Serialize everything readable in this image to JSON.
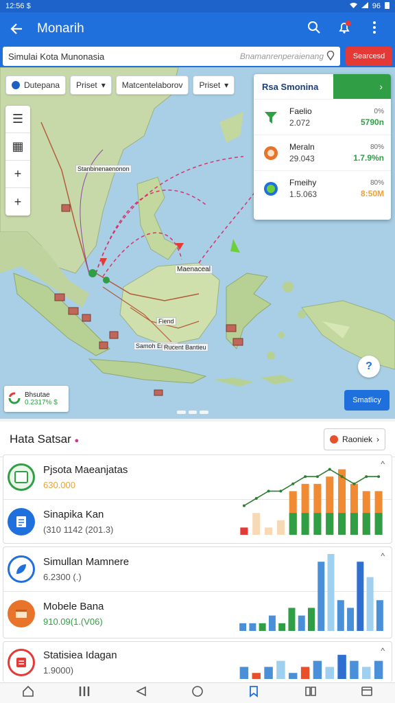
{
  "status_bar": {
    "time": "12:56 $",
    "battery": "96"
  },
  "app_bar": {
    "title": "Monarih"
  },
  "search": {
    "value": "Simulai Kota Munonasia",
    "hint": "Bnamanrenperaienang",
    "button": "Searcesd"
  },
  "filters": [
    "Dutepana",
    "Priset",
    "Matcentelaborov",
    "Priset"
  ],
  "map_labels": {
    "top": "Stanbinenaenonon",
    "center": "Maenaceal",
    "small1": "Samoh Enitoin",
    "small2": "Fiend",
    "small3": "Rucent Bantieu"
  },
  "legend": {
    "title": "Rsa Smonina",
    "rows": [
      {
        "name": "Faelio",
        "value": "2.072",
        "pct": "0%",
        "amount": "5790n",
        "amount_color": "#2f9e44"
      },
      {
        "name": "Meraln",
        "value": "29.043",
        "pct": "80%",
        "amount": "1.7.9%n",
        "amount_color": "#2f9e44"
      },
      {
        "name": "Fmeihy",
        "value": "1.5.063",
        "pct": "80%",
        "amount": "8:50M",
        "amount_color": "#e8a33b"
      }
    ]
  },
  "mini_card": {
    "label": "Bhsutae",
    "value": "0.2317% $"
  },
  "map_action": "Smatlicy",
  "data_section": {
    "title": "Hata Satsar",
    "report_button": "Raoniek",
    "rows": [
      {
        "title": "Pjsota Maeanjatas",
        "sub": "630.000",
        "sub_color": "#e8a33b"
      },
      {
        "title": "Sinapika Kan",
        "sub": "(310 1142 (201.3)",
        "sub_color": "#555"
      },
      {
        "title": "Simullan Mamnere",
        "sub": "6.2300 (.)",
        "sub_color": "#555"
      },
      {
        "title": "Mobele Bana",
        "sub": "910.09(1.(V06)",
        "sub_color": "#2f9e44"
      },
      {
        "title": "Statisiea Idagan",
        "sub": "1.9000)",
        "sub_color": "#555"
      }
    ]
  },
  "chart_data": [
    {
      "type": "bar",
      "series": [
        {
          "values": [
            1,
            3,
            1,
            2,
            6,
            7,
            7,
            8,
            9,
            7,
            6,
            6
          ],
          "color": "#f08a33"
        },
        {
          "values": [
            0,
            0,
            0,
            0,
            3,
            3,
            3,
            3,
            3,
            3,
            3,
            3
          ],
          "color": "#2f9e44"
        }
      ],
      "line": [
        4,
        5,
        6,
        6,
        7,
        8,
        8,
        9,
        8,
        7,
        8,
        8
      ],
      "ylim": [
        0,
        10
      ]
    },
    {
      "type": "bar",
      "values": [
        1,
        1,
        1,
        2,
        1,
        3,
        2,
        3,
        9,
        10,
        4,
        3,
        9,
        7,
        4
      ],
      "colors": [
        "#4a90d9",
        "#4a90d9",
        "#2f9e44",
        "#4a90d9",
        "#2f9e44",
        "#2f9e44",
        "#4a90d9",
        "#2f9e44",
        "#4a90d9",
        "#9fd0f0",
        "#4a90d9",
        "#4a90d9",
        "#2f6fd0",
        "#9fd0f0",
        "#4a90d9"
      ],
      "ylim": [
        0,
        10
      ]
    },
    {
      "type": "bar",
      "values": [
        2,
        1,
        2,
        3,
        1,
        2,
        3,
        2,
        4,
        3,
        2,
        3
      ],
      "colors": [
        "#4a90d9",
        "#e8502b",
        "#4a90d9",
        "#9fd0f0",
        "#4a90d9",
        "#e8502b",
        "#4a90d9",
        "#9fd0f0",
        "#2f6fd0",
        "#4a90d9",
        "#9fd0f0",
        "#4a90d9"
      ],
      "ylim": [
        0,
        5
      ]
    }
  ]
}
